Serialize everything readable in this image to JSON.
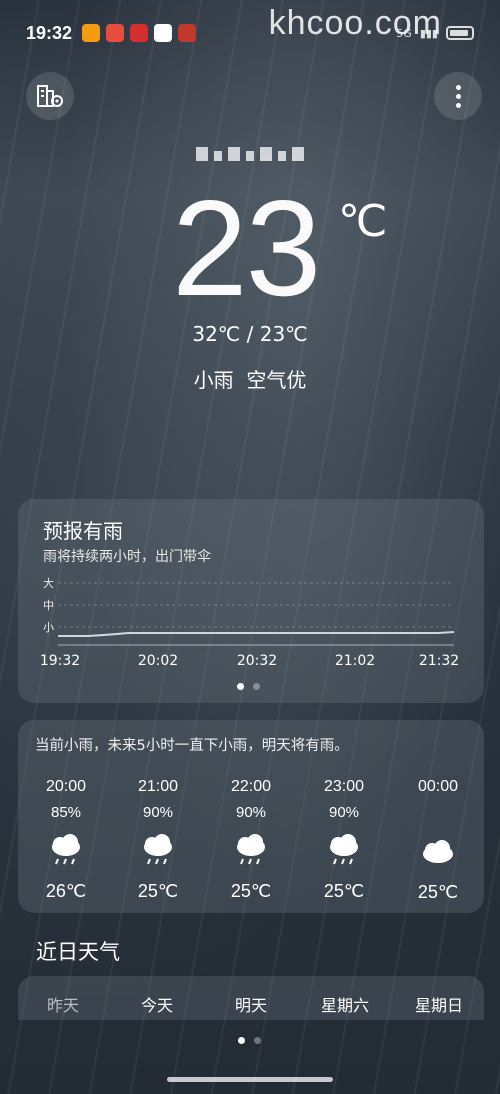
{
  "status_bar": {
    "time": "19:32",
    "app_icons": [
      "#f39c12",
      "#e74c3c",
      "#d32f2f",
      "#ffffff",
      "#c0392b"
    ],
    "watermark": "khcoo.com",
    "right_text": "5G"
  },
  "current": {
    "temperature": "23",
    "unit": "℃",
    "range": "32℃ / 23℃",
    "condition": "小雨  空气优"
  },
  "rain_card": {
    "title": "预报有雨",
    "subtitle": "雨将持续两小时，出门带伞",
    "levels": [
      "大",
      "中",
      "小"
    ],
    "times": [
      "19:32",
      "20:02",
      "20:32",
      "21:02",
      "21:32"
    ]
  },
  "hourly_card": {
    "summary": "当前小雨，未来5小时一直下小雨，明天将有雨。",
    "hours": [
      {
        "time": "20:00",
        "precip": "85%",
        "icon": "rain-cloud-icon",
        "temp": "26℃"
      },
      {
        "time": "21:00",
        "precip": "90%",
        "icon": "rain-cloud-icon",
        "temp": "25℃"
      },
      {
        "time": "22:00",
        "precip": "90%",
        "icon": "rain-cloud-icon",
        "temp": "25℃"
      },
      {
        "time": "23:00",
        "precip": "90%",
        "icon": "rain-cloud-icon",
        "temp": "25℃"
      },
      {
        "time": "00:00",
        "precip": "",
        "icon": "cloud-icon",
        "temp": "25℃"
      }
    ]
  },
  "recent": {
    "title": "近日天气",
    "days": [
      "昨天",
      "今天",
      "明天",
      "星期六",
      "星期日"
    ]
  },
  "colors": {
    "card_bg": "rgba(110,120,130,0.32)",
    "chart_line": "#cfd6dc"
  }
}
